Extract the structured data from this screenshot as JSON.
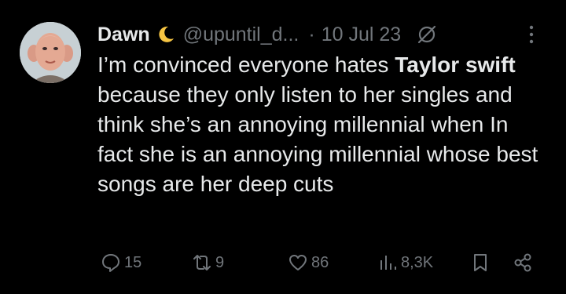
{
  "author": {
    "name": "Dawn",
    "emoji": "moon",
    "handle": "@upuntil_d...",
    "date": "10 Jul 23"
  },
  "body": {
    "t1": "I’m convinced everyone hates ",
    "b1": "Taylor swift",
    "t2": " because they only listen to her singles and think she’s an annoying millennial when In fact she is an annoying millennial whose best songs are her deep cuts"
  },
  "actions": {
    "replies": "15",
    "reposts": "9",
    "likes": "86",
    "views": "8,3K"
  },
  "colors": {
    "background": "#000000",
    "text": "#e7e9ea",
    "muted": "#71767b"
  },
  "icons": [
    "grok-icon",
    "more-icon",
    "reply-icon",
    "repost-icon",
    "like-icon",
    "views-icon",
    "bookmark-icon",
    "share-icon"
  ]
}
